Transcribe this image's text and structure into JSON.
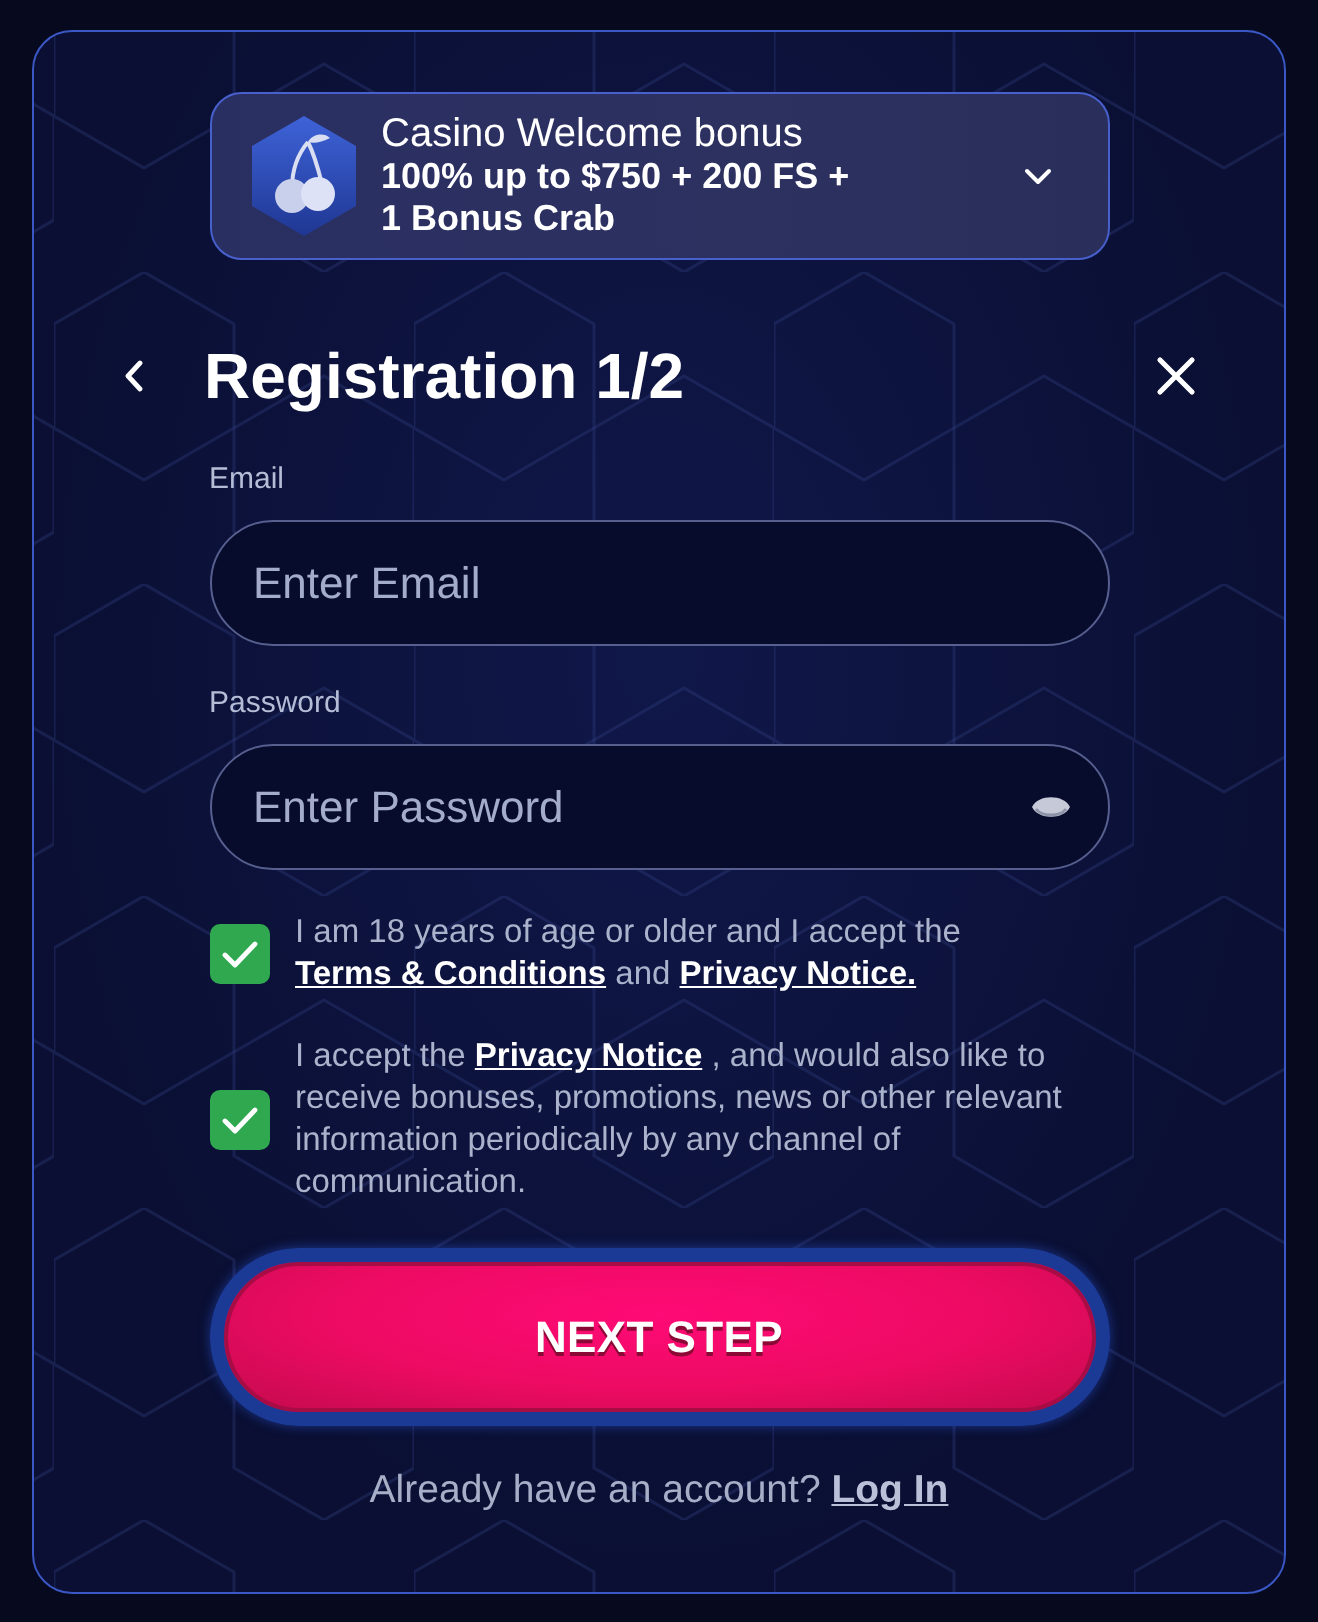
{
  "bonus": {
    "title": "Casino Welcome bonus",
    "offer": "100% up to $750 + 200 FS + 1 Bonus Crab",
    "expanded": false
  },
  "dialog": {
    "title": "Registration 1/2"
  },
  "fields": [
    {
      "kind": "email",
      "label": "Email",
      "placeholder": "Enter Email"
    },
    {
      "kind": "password",
      "label": "Password",
      "placeholder": "Enter Password"
    }
  ],
  "consents": [
    {
      "checked": true,
      "parts": [
        {
          "kind": "text",
          "text": "I am 18 years of age or older and I accept the"
        },
        {
          "kind": "link",
          "text": "Terms & Conditions"
        },
        {
          "kind": "text",
          "text": "and"
        },
        {
          "kind": "link",
          "text": "Privacy Notice."
        }
      ]
    },
    {
      "checked": true,
      "parts": [
        {
          "kind": "text",
          "text": "I accept the"
        },
        {
          "kind": "link",
          "text": "Privacy Notice"
        },
        {
          "kind": "text",
          "text": ", and would also like to receive bonuses, promotions, news or other relevant information periodically by any channel of communication."
        }
      ]
    }
  ],
  "submit": {
    "label": "NEXT STEP"
  },
  "footer": {
    "prompt": "Already have an account?",
    "link": "Log In"
  }
}
